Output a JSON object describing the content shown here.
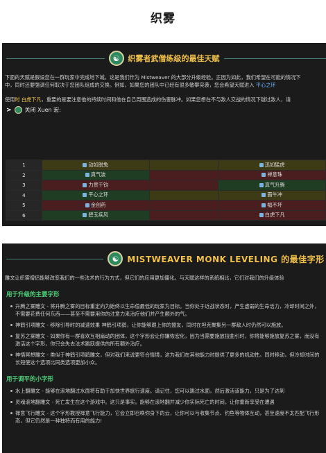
{
  "page": {
    "title": "织雾"
  },
  "panel1": {
    "banner_title": "织雾者武僧练级的最佳天赋",
    "intro_1": "下面的天赋是假设您在一群玩家中完成地下城，这是我们作为 Mistweaver 的大部分升级经验。正因为如此，我们希望在可能的情况下",
    "intro_2": "中，同时还要强调任何取决于您团队组成的交换。例如，如果您的团队中已经有很多敏攀突袭，您会希望天赋进入",
    "intro_2_hl": "平心之环",
    "intro_3a": "使用",
    "intro_3_hl": "时 白虎下凡",
    "intro_3b": "，重要的是要注意他的持续时间和他在自己周围造成的伤害脉冲。如果您想在不与敌人交战的情况下越过敌人，请",
    "toggle_label": "关闭 Xuen 宏:",
    "rows": [
      {
        "level": "1",
        "left": "动如脱兔",
        "right": "迅如猛虎"
      },
      {
        "level": "2",
        "left": "真气波",
        "right": "禅意珠"
      },
      {
        "level": "3",
        "left": "力贯千钧",
        "right": "真气升腾"
      },
      {
        "level": "4",
        "left": "平心之环",
        "right": "霸牛冲"
      },
      {
        "level": "5",
        "left": "金创药",
        "right": "幅不坏"
      },
      {
        "level": "6",
        "left": "碧玉疾风",
        "right": "白虎下凡"
      }
    ]
  },
  "panel2": {
    "banner_title": "MISTWEAVER MONK LEVELING 的最佳字形",
    "intro": "雕文让织雾僧侣能够改变我们的一些法术的行为方式，但它们的应用更加僵化。与天赋这样的系统相比，它们对我们的升级体验",
    "section1": "用于升级的主要字形",
    "bullets1": [
      "升腾之雾雕文 - 将升腾之雾的目标重定向为始终以生命值最低的玩家为目标。当你处于近战状态时，产生虚弱的生命活力，冷却时间之外，不需要花费任何东西——甚至不需要用你的注意力来治疗他们并产生额外的气。",
      "神鹤引项雕文 - 移除引导时的减速效果 神鹤引项鹞，让你能够跟上你的盟友，同时在坦克聚集另一群敌人时仍然可以施放。",
      "复苏之雾雕文 - 如果你有一群喜欢互相扇动的团体，这个字形会让你嫌恢宏化，因为当需要施放扭曲引时，你将能够施放复苏之雾，而没有激活这个字形，你只会失去法术跳跃提供的所有额外治疗。",
      "神悟冥想雕文 - 类似于神鹤引项鹞雕文，但对我们来说更符合情境，这为我们在其他能力时提供了更多的机动性。同时移动，但冷却时间的长短使这个选项比同类选项更加小众。"
    ],
    "section2": "用于调平的小字形",
    "bullets2": [
      "水上翻雕文 - 能够在滚地翻过水面将有助于加快世界旅行速度。请记住，您可以跳过水面，然后激活该能力，只是为了达到",
      "灵魂滚地翻雕文 - 死亡发生在这个游戏中。这只是事实。能够在滚地翻并减少你实际死亡的时间，让你重新享受在遭遇",
      "禅意飞行雕文 - 这个字形教授禅意飞行能力，它会立即召唤你身下的云，让你可以与收集节点、钓鱼等物体互动，甚至速度不太匹配飞行形态，但它仍然是一种独特而有用的能力!"
    ]
  },
  "colors": {
    "accent_gold": "#f0c04a",
    "accent_green": "#4fd37a",
    "panel_bg": "#1b1b1b"
  }
}
